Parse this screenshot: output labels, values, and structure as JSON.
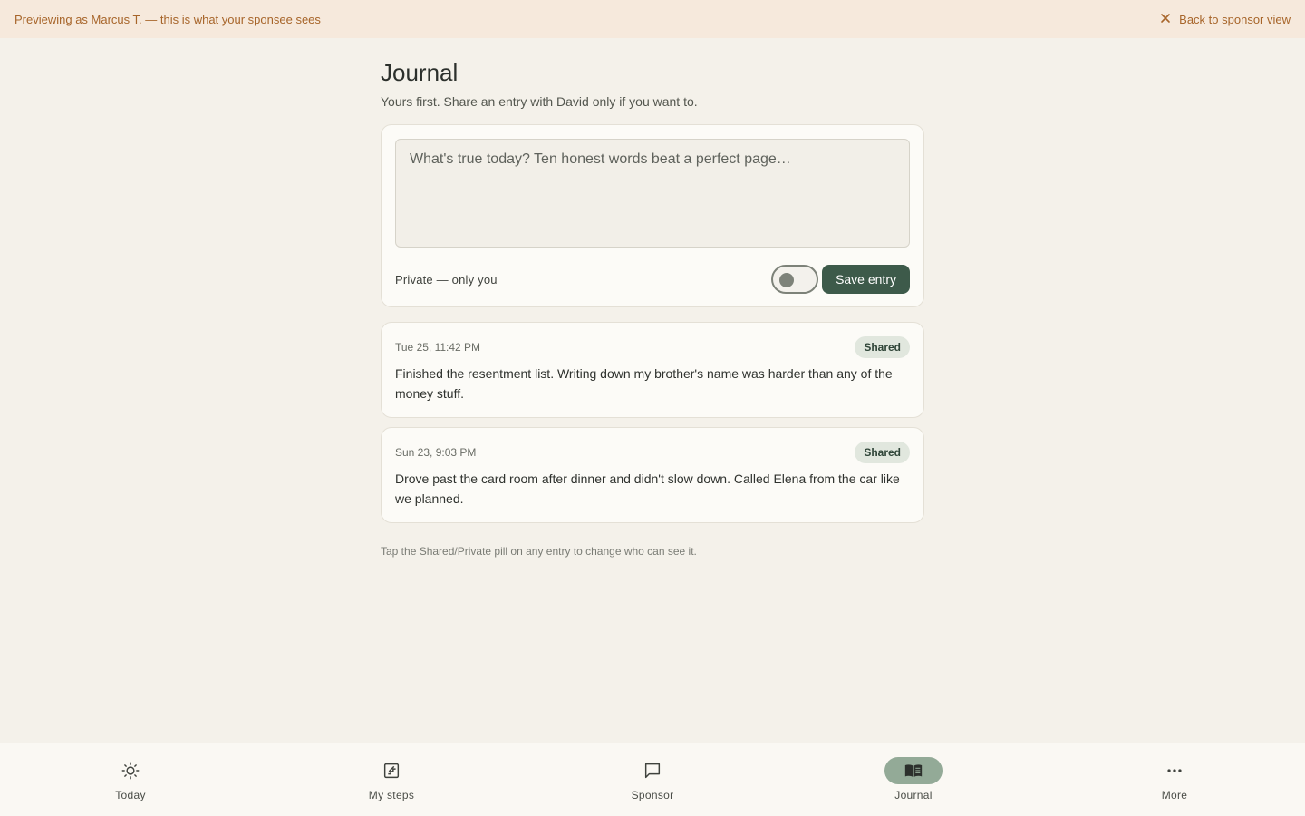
{
  "banner": {
    "preview_text": "Previewing as Marcus T. — this is what your sponsee sees",
    "back_label": "Back to sponsor view"
  },
  "page": {
    "title": "Journal",
    "subtitle": "Yours first. Share an entry with David only if you want to."
  },
  "composer": {
    "placeholder": "What's true today? Ten honest words beat a perfect page…",
    "value": "",
    "privacy_label": "Private — only you",
    "toggle_on": false,
    "save_label": "Save entry"
  },
  "entries": [
    {
      "date": "Tue 25, 11:42 PM",
      "visibility": "Shared",
      "text": "Finished the resentment list. Writing down my brother's name was harder than any of the money stuff."
    },
    {
      "date": "Sun 23, 9:03 PM",
      "visibility": "Shared",
      "text": "Drove past the card room after dinner and didn't slow down. Called Elena from the car like we planned."
    }
  ],
  "hint": "Tap the Shared/Private pill on any entry to change who can see it.",
  "nav": {
    "items": [
      {
        "label": "Today",
        "icon": "sun-icon",
        "active": false
      },
      {
        "label": "My steps",
        "icon": "steps-icon",
        "active": false
      },
      {
        "label": "Sponsor",
        "icon": "chat-icon",
        "active": false
      },
      {
        "label": "Journal",
        "icon": "book-icon",
        "active": true
      },
      {
        "label": "More",
        "icon": "more-icon",
        "active": false
      }
    ]
  },
  "colors": {
    "background": "#f4f1ea",
    "banner_bg": "#f6e9dc",
    "banner_text": "#a7652a",
    "primary": "#3d5a4a",
    "active_nav_pill": "#93aa97",
    "shared_pill_bg": "#e1e7de"
  }
}
